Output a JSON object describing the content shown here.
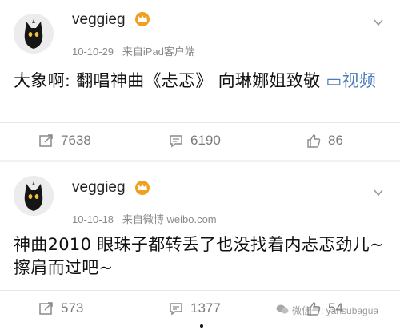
{
  "posts": [
    {
      "username": "veggieg",
      "date": "10-10-29",
      "source": "来自iPad客户端",
      "text": "大象啊: 翻唱神曲《忐忑》 向琳娜姐致敬 ",
      "link_label": "视频",
      "reposts": "7638",
      "comments": "6190",
      "likes": "86"
    },
    {
      "username": "veggieg",
      "date": "10-10-18",
      "source": "来自微博 weibo.com",
      "text": "神曲2010 眼珠子都转丢了也没找着内忐忑劲儿~ 擦肩而过吧~",
      "reposts": "573",
      "comments": "1377",
      "likes": "54"
    }
  ],
  "watermark": "微信号: yansubagua",
  "icons": {
    "avatar": "black-cat-avatar-icon",
    "badge": "vip-crown-icon",
    "menu": "chevron-down-icon",
    "repost": "repost-icon",
    "comment": "comment-icon",
    "like": "thumbs-up-icon",
    "video": "video-play-icon",
    "wechat": "wechat-icon"
  },
  "colors": {
    "link": "#4a7bbd",
    "badge": "#f0a020"
  }
}
